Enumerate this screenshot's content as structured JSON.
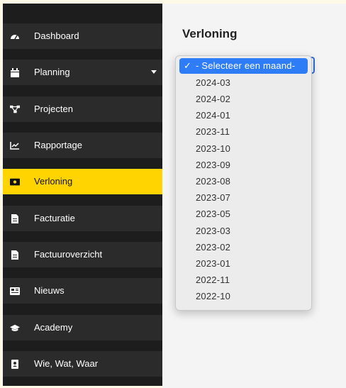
{
  "sidebar": {
    "items": [
      {
        "label": "Dashboard",
        "icon": "dashboard-gauge-icon"
      },
      {
        "label": "Planning",
        "icon": "calendar-icon",
        "has_caret": true
      },
      {
        "label": "Projecten",
        "icon": "project-network-icon"
      },
      {
        "label": "Rapportage",
        "icon": "line-chart-icon"
      },
      {
        "label": "Verloning",
        "icon": "money-bill-icon",
        "active": true
      },
      {
        "label": "Facturatie",
        "icon": "document-icon"
      },
      {
        "label": "Factuuroverzicht",
        "icon": "document-icon"
      },
      {
        "label": "Nieuws",
        "icon": "newspaper-icon"
      },
      {
        "label": "Academy",
        "icon": "graduation-cap-icon"
      },
      {
        "label": "Wie, Wat, Waar",
        "icon": "address-book-icon"
      }
    ],
    "active_color": "#ffd400"
  },
  "main": {
    "title": "Verloning"
  },
  "month_select": {
    "options": [
      "- Selecteer een maand-",
      "2024-03",
      "2024-02",
      "2024-01",
      "2023-11",
      "2023-10",
      "2023-09",
      "2023-08",
      "2023-07",
      "2023-05",
      "2023-03",
      "2023-02",
      "2023-01",
      "2022-11",
      "2022-10"
    ],
    "selected_label": "- Selecteer een maand-",
    "check_glyph": "✓",
    "highlight_color": "#2f7df6"
  }
}
